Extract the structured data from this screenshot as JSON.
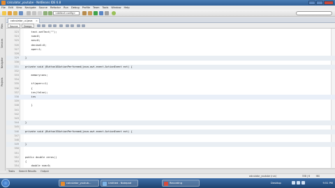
{
  "window": {
    "title": "calculator_youtube - NetBeans IDE 6.8"
  },
  "menu": [
    "File",
    "Edit",
    "View",
    "Navigate",
    "Source",
    "Refactor",
    "Run",
    "Debug",
    "Profile",
    "Team",
    "Tools",
    "Window",
    "Help"
  ],
  "toolbar": {
    "config_combo": "<default config>"
  },
  "left_strip": [
    "Files",
    "Services",
    "Navigator",
    "Projects"
  ],
  "editor_tab": {
    "label": "calculator_ui.java",
    "close": "×"
  },
  "modes": {
    "source": "Source",
    "design": "Design"
  },
  "code_lines": [
    {
      "n": "323",
      "text": "    text.setText(\"\");",
      "style": ""
    },
    {
      "n": "324",
      "text": "    num=0;",
      "style": ""
    },
    {
      "n": "325",
      "text": "    ans=0;",
      "style": ""
    },
    {
      "n": "326",
      "text": "    decimal=0;",
      "style": ""
    },
    {
      "n": "327",
      "text": "    oper=1;",
      "style": ""
    },
    {
      "n": "328",
      "text": "",
      "style": ""
    },
    {
      "n": "329",
      "text": "}",
      "style": "guarded"
    },
    {
      "n": "330",
      "text": "",
      "style": ""
    },
    {
      "n": "331",
      "text": "private void jButton16ActionPerformed(java.awt.event.ActionEvent evt) {",
      "style": "guarded"
    },
    {
      "n": "332",
      "text": "",
      "style": ""
    },
    {
      "n": "333",
      "text": "    memory=ans;",
      "style": ""
    },
    {
      "n": "334",
      "text": "",
      "style": ""
    },
    {
      "n": "335",
      "text": "    if(oper==1)",
      "style": ""
    },
    {
      "n": "336",
      "text": "    {",
      "style": ""
    },
    {
      "n": "337",
      "text": "    ins(false);",
      "style": ""
    },
    {
      "n": "338",
      "text": "    ins",
      "style": "current"
    },
    {
      "n": "339",
      "text": "",
      "style": ""
    },
    {
      "n": "340",
      "text": "    }",
      "style": ""
    },
    {
      "n": "341",
      "text": "",
      "style": ""
    },
    {
      "n": "342",
      "text": "",
      "style": ""
    },
    {
      "n": "343",
      "text": "",
      "style": ""
    },
    {
      "n": "344",
      "text": "}",
      "style": "guarded"
    },
    {
      "n": "345",
      "text": "",
      "style": ""
    },
    {
      "n": "346",
      "text": "private void jButton19ActionPerformed(java.awt.event.ActionEvent evt) {",
      "style": "guarded"
    },
    {
      "n": "347",
      "text": "",
      "style": ""
    },
    {
      "n": "348",
      "text": "",
      "style": ""
    },
    {
      "n": "349",
      "text": "}",
      "style": "guarded"
    },
    {
      "n": "350",
      "text": "",
      "style": ""
    },
    {
      "n": "351",
      "text": "",
      "style": ""
    },
    {
      "n": "352",
      "text": "public double zeros()",
      "style": ""
    },
    {
      "n": "353",
      "text": "{",
      "style": ""
    },
    {
      "n": "354",
      "text": "    double num=0;",
      "style": ""
    }
  ],
  "bottom_tabs": [
    "Tasks",
    "Search Results",
    "Output"
  ],
  "status": {
    "project": "calculator_youtube (run)",
    "position": "338 | 6",
    "mode": "INS"
  },
  "taskbar": {
    "tasks": [
      "calculator_youtub...",
      "Untitled - Notepad",
      "Recording"
    ],
    "desktop": "Desktop",
    "clock": "9:51 PM"
  }
}
